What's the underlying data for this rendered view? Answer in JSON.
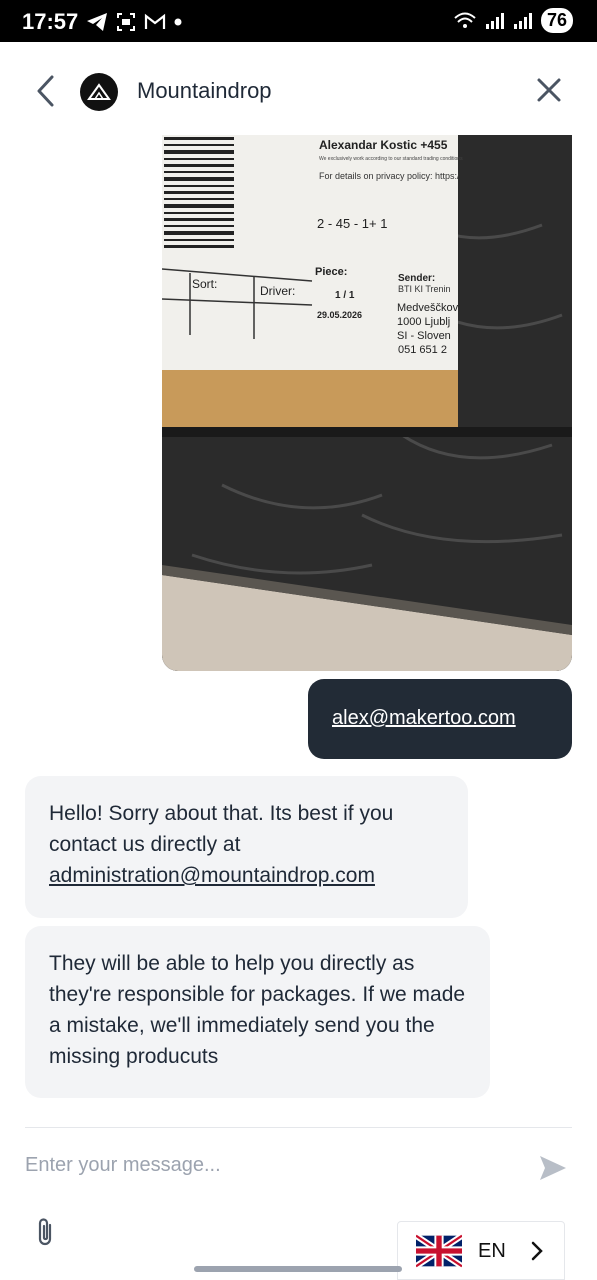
{
  "status_bar": {
    "time": "17:57",
    "battery": "76"
  },
  "header": {
    "title": "Mountaindrop"
  },
  "photo_label": {
    "name": "Alexandar Kostic +455",
    "small_line": "We exclusively work according to our standard trading conditions",
    "privacy": "For details on privacy policy: https:/",
    "code": "2 - 45 - 1+ 1",
    "piece_label": "Piece:",
    "piece_value": "1 / 1",
    "date": "29.05.2026",
    "sort_label": "Sort:",
    "driver_label": "Driver:",
    "sender_label": "Sender:",
    "sender_lines": [
      "BTI KI Trenin",
      "Medveščkov",
      "1000 Ljublj",
      "SI - Sloven",
      "051 651 2"
    ]
  },
  "messages": {
    "user_email": "alex@makertoo.com",
    "reply1_text": "Hello! Sorry about that. Its best if you contact us directly at",
    "reply1_link": "administration@mountaindrop.com",
    "reply2_text": "They will be able to help you directly as they're responsible for packages. If we made a mistake, we'll immediately send you the missing producuts"
  },
  "composer": {
    "placeholder": "Enter your message..."
  },
  "language": {
    "code": "EN"
  },
  "colors": {
    "user_bubble": "#222b36",
    "bot_bubble": "#f3f4f6",
    "accent_icon": "#4b5563"
  }
}
